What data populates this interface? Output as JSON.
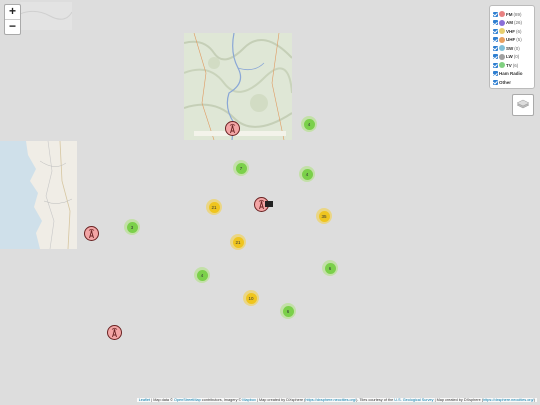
{
  "zoom": {
    "in_label": "+",
    "out_label": "−"
  },
  "legend": {
    "items": [
      {
        "label": "FM",
        "count": "(89)",
        "checked": true,
        "icon_color": "#e88080"
      },
      {
        "label": "AM",
        "count": "(26)",
        "checked": true,
        "icon_color": "#8a6fd8"
      },
      {
        "label": "VHF",
        "count": "(6)",
        "checked": true,
        "icon_color": "#e8d070"
      },
      {
        "label": "UHF",
        "count": "(5)",
        "checked": true,
        "icon_color": "#e8a060"
      },
      {
        "label": "SW",
        "count": "(0)",
        "checked": true,
        "icon_color": "#80c0d8"
      },
      {
        "label": "LW",
        "count": "(0)",
        "checked": true,
        "icon_color": "#a0a0a0"
      },
      {
        "label": "TV",
        "count": "(6)",
        "checked": true,
        "icon_color": "#80d080"
      },
      {
        "label": "Ham Radio",
        "count": "",
        "checked": true,
        "icon_color": ""
      },
      {
        "label": "Other",
        "count": "",
        "checked": true,
        "icon_color": ""
      }
    ]
  },
  "clusters": [
    {
      "count": "4",
      "color": "green"
    },
    {
      "count": "7",
      "color": "green"
    },
    {
      "count": "4",
      "color": "green"
    },
    {
      "count": "21",
      "color": "yellow"
    },
    {
      "count": "35",
      "color": "yellow"
    },
    {
      "count": "3",
      "color": "green"
    },
    {
      "count": "21",
      "color": "yellow"
    },
    {
      "count": "6",
      "color": "green"
    },
    {
      "count": "4",
      "color": "green"
    },
    {
      "count": "10",
      "color": "yellow"
    },
    {
      "count": "6",
      "color": "green"
    }
  ],
  "attribution": {
    "leaflet": "Leaflet",
    "t1": " | Map data © ",
    "osm": "OpenStreetMap",
    "t2": " contributors, Imagery © ",
    "mapbox": "Mapbox",
    "t3": " | Map created by DXsphere (",
    "dx1": "https://dxsphere.neocities.org/",
    "t4": "). Tiles courtesy of the ",
    "usgs": "U.S. Geological Survey",
    "t5": " | Map created by DXsphere (",
    "dx2": "https://dxsphere.neocities.org/",
    "t6": ")"
  }
}
